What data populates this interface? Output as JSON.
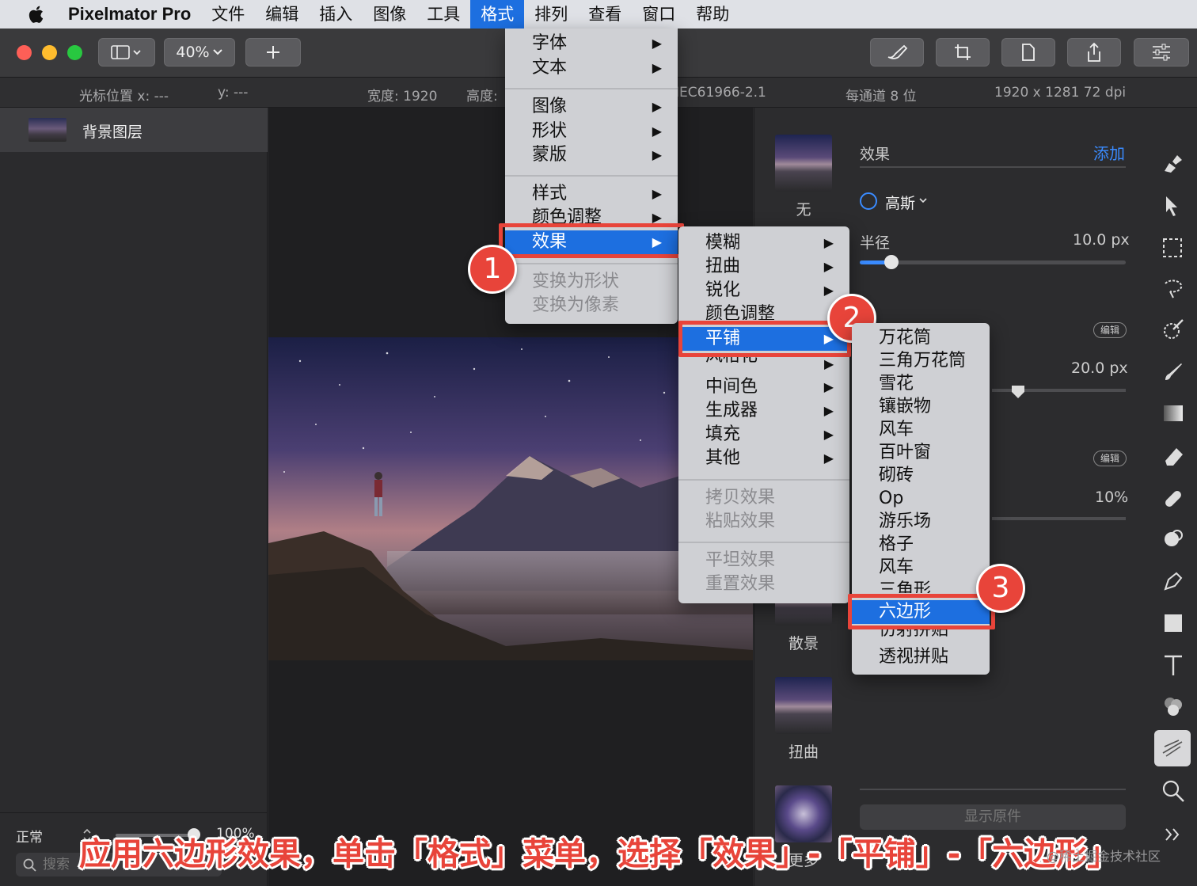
{
  "menubar": {
    "app_name": "Pixelmator Pro",
    "items": [
      "文件",
      "编辑",
      "插入",
      "图像",
      "工具",
      "格式",
      "排列",
      "查看",
      "窗口",
      "帮助"
    ]
  },
  "toolbar": {
    "zoom": "40%"
  },
  "infobar": {
    "cursor_x": "光标位置 x:  ---",
    "cursor_y": "y:  ---",
    "width": "宽度:  1920",
    "height": "高度:",
    "color_profile": "IEC61966-2.1",
    "bits": "每通道 8 位",
    "size_dpi": "1920 x 1281 72 dpi"
  },
  "layers": {
    "layer_name": "背景图层",
    "blend_mode": "正常",
    "opacity": "100%",
    "search_placeholder": "搜索"
  },
  "effects_panel": {
    "title": "效果",
    "add": "添加",
    "effect_name": "高斯",
    "radius_label": "半径",
    "radius_value": "10.0 px",
    "radius_fraction": 0.12,
    "value2": "20.0 px",
    "value3": "10%",
    "edit": "编辑",
    "show_original": "显示原件",
    "thumbs": [
      "无",
      "散景",
      "扭曲",
      "更多"
    ]
  },
  "format_menu": {
    "groups": [
      [
        "字体",
        "文本"
      ],
      [
        "图像",
        "形状",
        "蒙版"
      ],
      [
        "样式",
        "颜色调整",
        "效果"
      ],
      [
        "变换为形状",
        "变换为像素"
      ]
    ]
  },
  "effects_menu": {
    "groups": [
      [
        "模糊",
        "扭曲",
        "锐化",
        "颜色调整",
        "平铺",
        "风格化",
        "中间色",
        "生成器",
        "填充",
        "其他"
      ],
      [
        "拷贝效果",
        "粘贴效果"
      ],
      [
        "平坦效果",
        "重置效果"
      ]
    ]
  },
  "tile_menu": {
    "items": [
      "万花筒",
      "三角万花筒",
      "雪花",
      "镶嵌物",
      "风车",
      "百叶窗",
      "砌砖",
      "Op",
      "游乐场",
      "格子",
      "风车",
      "三角形",
      "六边形",
      "仿射拼贴",
      "透视拼贴"
    ]
  },
  "steps": [
    "1",
    "2",
    "3"
  ],
  "caption": "应用六边形效果，单击「格式」菜单，选择「效果」-「平铺」-「六边形」",
  "watermark": "@稀土掘金技术社区",
  "colors": {
    "accent": "#1d6fe0",
    "annotation": "#e8443a"
  }
}
